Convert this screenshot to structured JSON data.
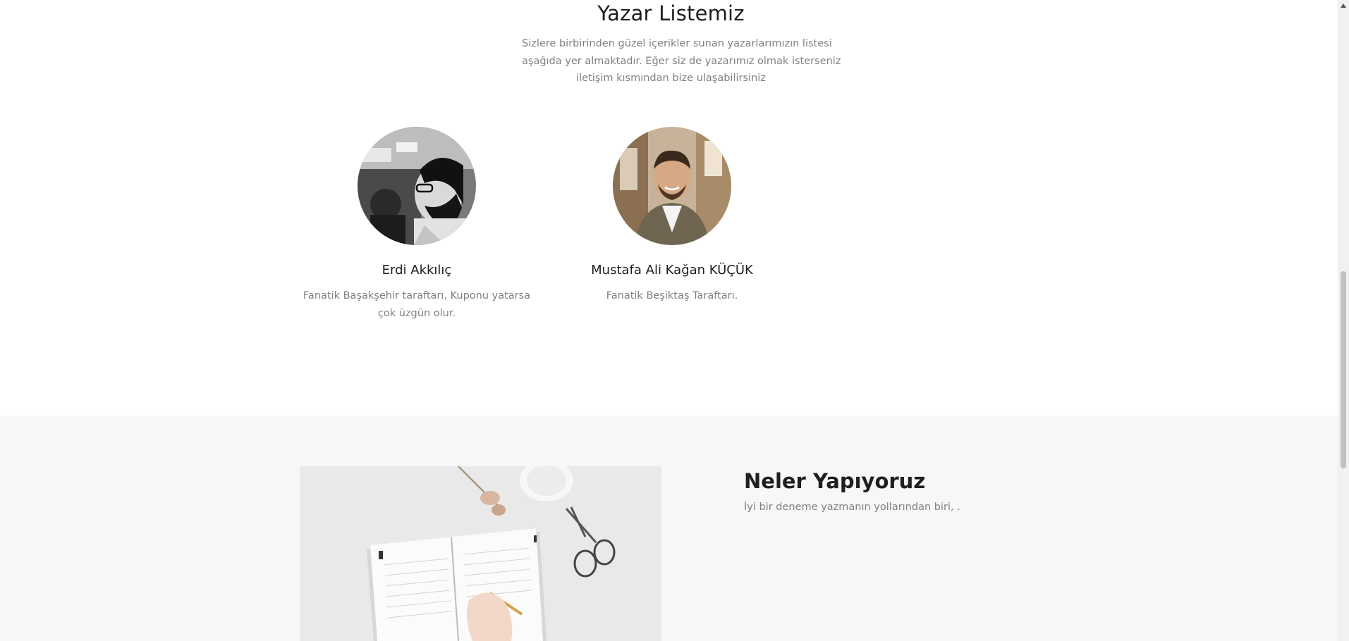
{
  "authors_section": {
    "title": "Yazar Listemiz",
    "lead_lines": [
      "Sizlere birbirinden güzel içerikler sunan yazarlarımızın listesi",
      "aşağıda yer almaktadır. Eğer siz de yazarımız olmak isterseniz",
      "iletişim kısmından bize ulaşabilirsiniz"
    ],
    "authors": [
      {
        "name": "Erdi Akkılıç",
        "bio": "Fanatik Başakşehir taraftarı, Kuponu yatarsa çok üzgün olur."
      },
      {
        "name": "Mustafa Ali Kağan KÜÇÜK",
        "bio": "Fanatik Beşiktaş Taraftarı."
      }
    ]
  },
  "services_section": {
    "title": "Neler Yapıyoruz",
    "text": "İyi bir deneme yazmanın yollarından biri, ."
  },
  "colors": {
    "heading": "#1f1f1f",
    "body_text": "#808080",
    "section_alt_bg": "#f6f7f9",
    "top_border": "#3a2630"
  },
  "icons": {
    "scroll_up": "triangle-up-icon"
  }
}
